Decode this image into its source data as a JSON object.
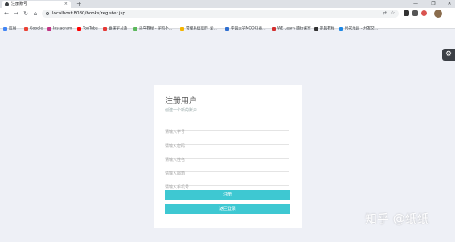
{
  "browser": {
    "tab_title": "注册账号",
    "tab_close": "×",
    "new_tab": "+",
    "url": "localhost:8080/books/register.jsp",
    "nav": {
      "back": "←",
      "forward": "→",
      "reload": "↻",
      "home": "⌂"
    },
    "window_controls": {
      "minimize": "—",
      "restore": "❐",
      "close": "✕"
    },
    "menu": "⋮"
  },
  "bookmarks": [
    {
      "label": "应用",
      "color": "#4285f4"
    },
    {
      "label": "Google",
      "color": "#ea4335"
    },
    {
      "label": "Instagram",
      "color": "#c13584"
    },
    {
      "label": "YouTube",
      "color": "#ff0000"
    },
    {
      "label": "嘉课学习通",
      "color": "#e53935"
    },
    {
      "label": "菜鸟教程 - 学的不...",
      "color": "#5cb85c"
    },
    {
      "label": "管理系统或的_全...",
      "color": "#f4b400"
    },
    {
      "label": "中国大学MOOC(慕...",
      "color": "#2f6fd0"
    },
    {
      "label": "WE Learn 随行课堂",
      "color": "#d32f2f"
    },
    {
      "label": "抓狐教程",
      "color": "#333333"
    },
    {
      "label": "码农乐园 - 开发交...",
      "color": "#1e88e5"
    }
  ],
  "settings_icon": "⚙",
  "form": {
    "title": "注册用户",
    "subtitle": "创建一个新的账户",
    "fields": [
      {
        "name": "student-id",
        "placeholder": "请输入学号"
      },
      {
        "name": "password",
        "placeholder": "请输入密码"
      },
      {
        "name": "full-name",
        "placeholder": "请输入姓名"
      },
      {
        "name": "email",
        "placeholder": "请输入邮箱"
      },
      {
        "name": "phone",
        "placeholder": "请输入手机号"
      }
    ],
    "register_label": "注册",
    "back_login_label": "返回登录",
    "button_color": "#3ec8d2"
  },
  "watermark": "知乎 @纸纸"
}
